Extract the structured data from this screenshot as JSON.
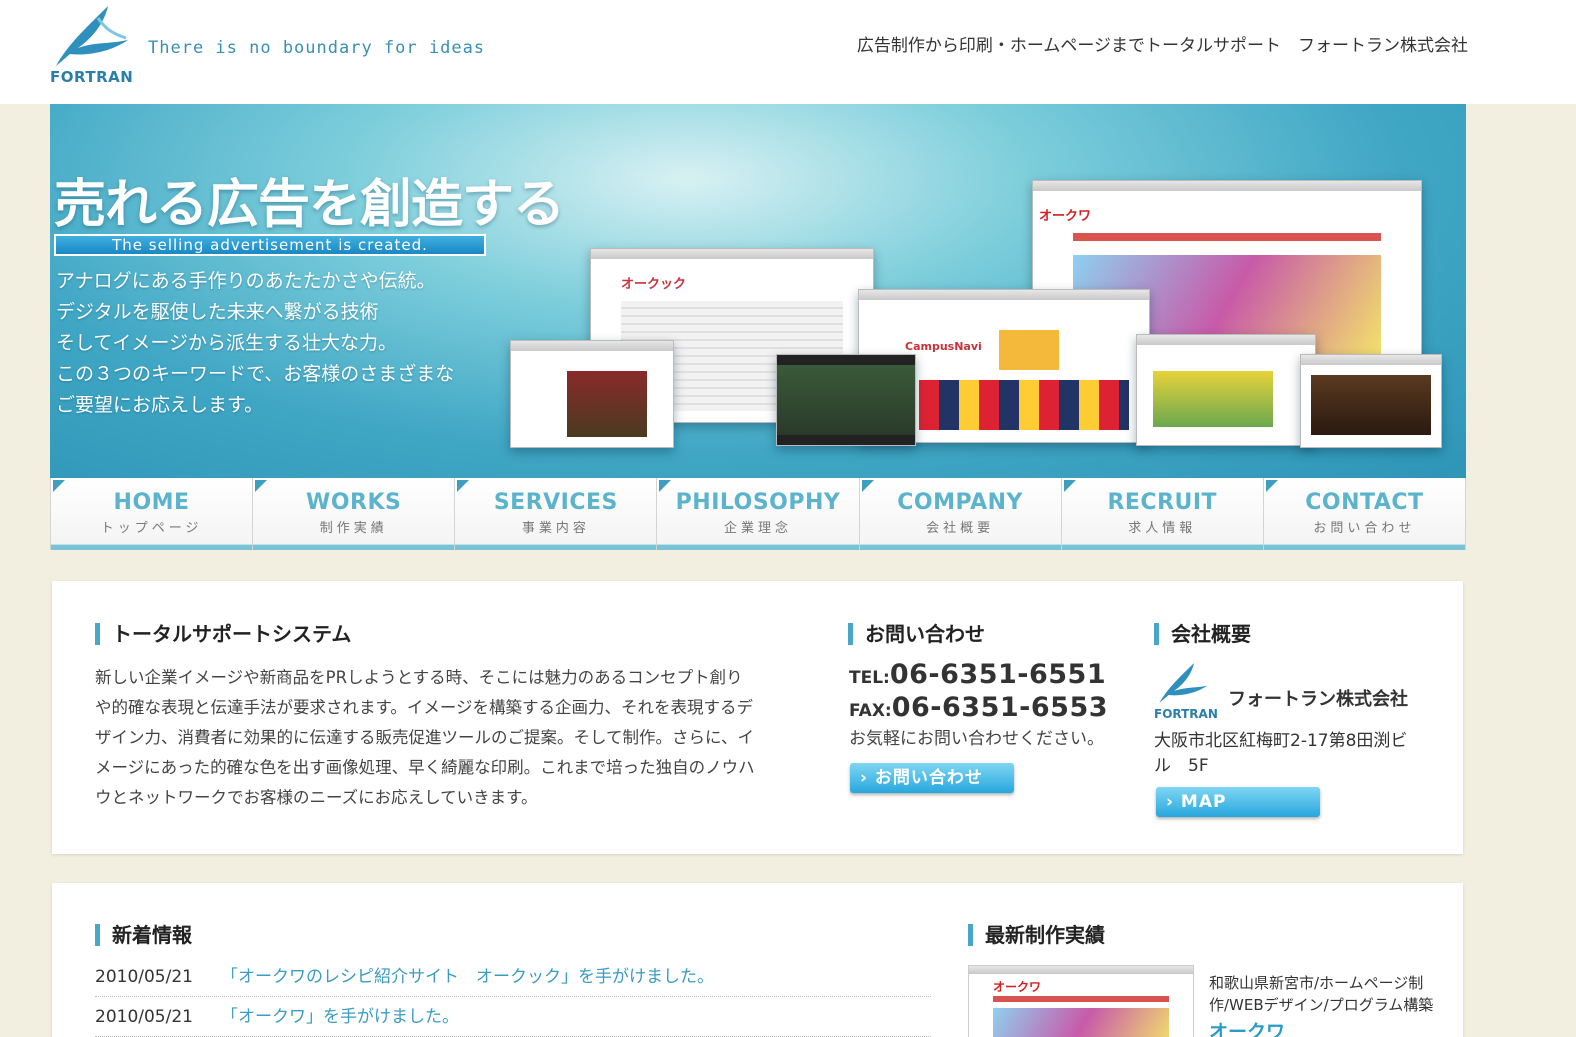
{
  "header": {
    "logo_text": "FORTRAN",
    "tagline": "There is no boundary for ideas",
    "right_text": "広告制作から印刷・ホームページまでトータルサポート　フォートラン株式会社"
  },
  "hero": {
    "title": "売れる広告を創造する",
    "subtitle": "The selling advertisement is created.",
    "lines": [
      "アナログにある手作りのあたたかさや伝統。",
      "デジタルを駆使した未来へ繋がる技術",
      "そしてイメージから派生する壮大な力。",
      "この３つのキーワードで、お客様のさまざまな",
      "ご要望にお応えします。"
    ],
    "shot_labels": {
      "okuwa": "オークワ",
      "okuck": "オークック",
      "campus": "CampusNavi"
    }
  },
  "nav": [
    {
      "en": "HOME",
      "ja": "トップページ"
    },
    {
      "en": "WORKS",
      "ja": "制作実績"
    },
    {
      "en": "SERVICES",
      "ja": "事業内容"
    },
    {
      "en": "PHILOSOPHY",
      "ja": "企業理念"
    },
    {
      "en": "COMPANY",
      "ja": "会社概要"
    },
    {
      "en": "RECRUIT",
      "ja": "求人情報"
    },
    {
      "en": "CONTACT",
      "ja": "お問い合わせ"
    }
  ],
  "support": {
    "heading": "トータルサポートシステム",
    "lines": [
      "新しい企業イメージや新商品をPRしようとする時、そこには魅力のあるコンセプト創り",
      "や的確な表現と伝達手法が要求されます。イメージを構築する企画力、それを表現するデ",
      "ザイン力、消費者に効果的に伝達する販売促進ツールのご提案。そして制作。さらに、イ",
      "メージにあった的確な色を出す画像処理、早く綺麗な印刷。これまで培った独自のノウハ",
      "ウとネットワークでお客様のニーズにお応えしていきます。"
    ]
  },
  "contact": {
    "heading": "お問い合わせ",
    "tel_label": "TEL:",
    "tel": "06-6351-6551",
    "fax_label": "FAX:",
    "fax": "06-6351-6553",
    "note": "お気軽にお問い合わせください。",
    "button": "› お問い合わせ"
  },
  "company": {
    "heading": "会社概要",
    "logo_text": "FORTRAN",
    "name": "フォートラン株式会社",
    "address_line1": "大阪市北区紅梅町2-17第8田渕ビ",
    "address_line2": "ル　5F",
    "map_button": "› MAP"
  },
  "news": {
    "heading": "新着情報",
    "items": [
      {
        "date": "2010/05/21",
        "title": "「オークワのレシピ紹介サイト　オークック」を手がけました。"
      },
      {
        "date": "2010/05/21",
        "title": "「オークワ」を手がけました。"
      }
    ]
  },
  "works": {
    "heading": "最新制作実績",
    "thumb_label": "オークワ",
    "description": "和歌山県新宮市/ホームページ制作/WEBデザイン/プログラム構築",
    "name": "オークワ"
  },
  "colors": {
    "accent": "#4aa6c8",
    "hero": "#3fa6c4",
    "link": "#3a9cc0",
    "page_bg": "#f3efe0"
  }
}
